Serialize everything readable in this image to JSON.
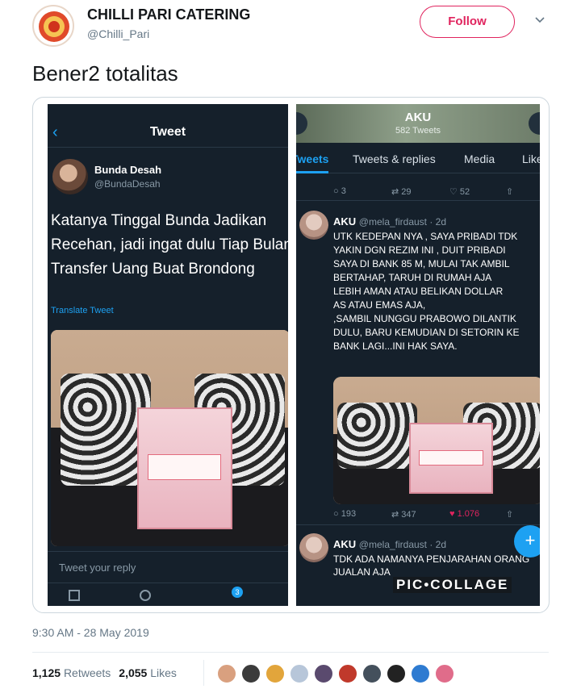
{
  "account": {
    "display_name": "CHILLI PARI CATERING",
    "handle": "@Chilli_Pari",
    "follow_label": "Follow"
  },
  "tweet": {
    "text": "Bener2 totalitas",
    "timestamp": "9:30 AM - 28 May 2019",
    "retweets_count": "1,125",
    "retweets_label": "Retweets",
    "likes_count": "2,055",
    "likes_label": "Likes"
  },
  "left_shot": {
    "nav_title": "Tweet",
    "author_name": "Bunda Desah",
    "author_handle": "@BundaDesah",
    "text": "Katanya Tinggal Bunda Jadikan Recehan, jadi ingat dulu Tiap Bulan Transfer Uang Buat Brondong",
    "translate_label": "Translate Tweet",
    "reply_placeholder": "Tweet your reply",
    "notification_badge": "3"
  },
  "right_shot": {
    "profile_name": "AKU",
    "tweet_count": "582 Tweets",
    "tabs": [
      "Tweets",
      "Tweets & replies",
      "Media",
      "Likes"
    ],
    "top_actions": {
      "replies": "3",
      "retweets": "29",
      "likes": "52"
    },
    "tweet1": {
      "name": "AKU",
      "meta": "@mela_firdaust · 2d",
      "text": "UTK KEDEPAN NYA , SAYA PRIBADI TDK\nYAKIN  DGN REZIM INI , DUIT PRIBADI\nSAYA DI BANK 85 M, MULAI TAK AMBIL\nBERTAHAP, TARUH DI RUMAH AJA\nLEBIH AMAN ATAU  BELIKAN DOLLAR\nAS ATAU  EMAS AJA,\n,SAMBIL NUNGGU PRABOWO DILANTIK\nDULU, BARU KEMUDIAN DI SETORIN KE\nBANK LAGI...INI HAK  SAYA.",
      "replies": "193",
      "retweets": "347",
      "likes": "1.076"
    },
    "tweet2": {
      "name": "AKU",
      "meta": "@mela_firdaust · 2d",
      "text": "TDK ADA NAMANYA PENJARAHAN  ORANG  JUALAN AJA"
    },
    "watermark": "PIC•COLLAGE"
  },
  "icons": {
    "caret": "chevron-down-icon",
    "back": "back-arrow-icon",
    "reply": "reply-icon",
    "retweet": "retweet-icon",
    "like": "heart-icon",
    "share": "share-icon",
    "compose": "compose-plus-icon"
  },
  "colors": {
    "accent": "#e0245e",
    "twitter_blue": "#1da1f2",
    "dark_bg": "#15202b",
    "muted": "#657786"
  }
}
